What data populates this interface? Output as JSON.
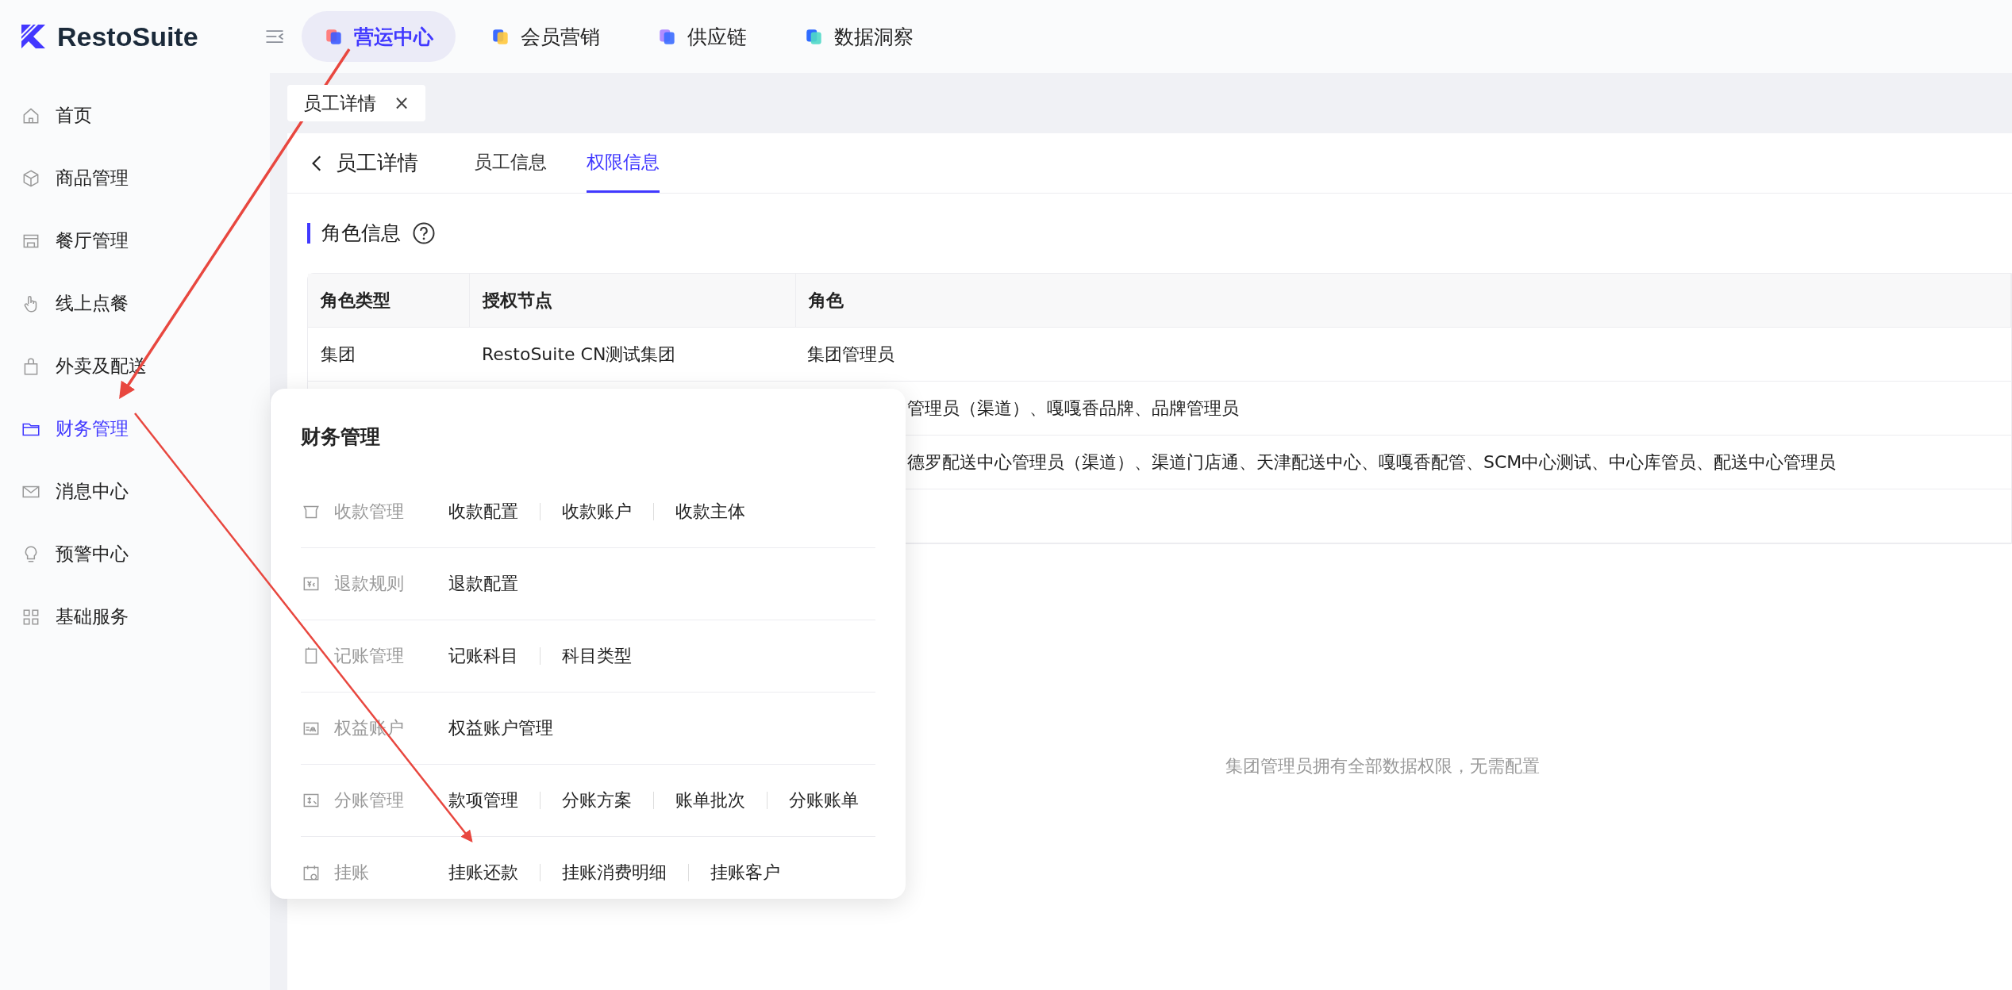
{
  "brand": {
    "name": "RestoSuite"
  },
  "top_nav": [
    {
      "label": "营运中心",
      "selected": true
    },
    {
      "label": "会员营销",
      "selected": false
    },
    {
      "label": "供应链",
      "selected": false
    },
    {
      "label": "数据洞察",
      "selected": false
    }
  ],
  "sidebar": {
    "items": [
      {
        "label": "首页",
        "selected": false
      },
      {
        "label": "商品管理",
        "selected": false
      },
      {
        "label": "餐厅管理",
        "selected": false
      },
      {
        "label": "线上点餐",
        "selected": false
      },
      {
        "label": "外卖及配送",
        "selected": false
      },
      {
        "label": "财务管理",
        "selected": true
      },
      {
        "label": "消息中心",
        "selected": false
      },
      {
        "label": "预警中心",
        "selected": false
      },
      {
        "label": "基础服务",
        "selected": false
      }
    ]
  },
  "page_tabs": [
    {
      "label": "员工详情",
      "close": "×"
    }
  ],
  "header": {
    "back_title": "员工详情",
    "tabs": [
      {
        "label": "员工信息",
        "selected": false
      },
      {
        "label": "权限信息",
        "selected": true
      }
    ]
  },
  "section": {
    "title": "角色信息"
  },
  "table": {
    "columns": [
      "角色类型",
      "授权节点",
      "角色"
    ],
    "rows": [
      {
        "type": "集团",
        "node": "RestoSuite CN测试集团",
        "role": "集团管理员"
      },
      {
        "role": "管理员（渠道）、嘎嘎香品牌、品牌管理员"
      },
      {
        "role": "德罗配送中心管理员（渠道）、渠道门店通、天津配送中心、嘎嘎香配管、SCM中心测试、中心库管员、配送中心管理员"
      }
    ]
  },
  "empty_message": "集团管理员拥有全部数据权限，无需配置",
  "flyout": {
    "title": "财务管理",
    "groups": [
      {
        "label": "收款管理",
        "links": [
          "收款配置",
          "收款账户",
          "收款主体"
        ]
      },
      {
        "label": "退款规则",
        "links": [
          "退款配置"
        ]
      },
      {
        "label": "记账管理",
        "links": [
          "记账科目",
          "科目类型"
        ]
      },
      {
        "label": "权益账户",
        "links": [
          "权益账户管理"
        ]
      },
      {
        "label": "分账管理",
        "links": [
          "款项管理",
          "分账方案",
          "账单批次",
          "分账账单"
        ]
      },
      {
        "label": "挂账",
        "links": [
          "挂账还款",
          "挂账消费明细",
          "挂账客户"
        ]
      }
    ]
  }
}
